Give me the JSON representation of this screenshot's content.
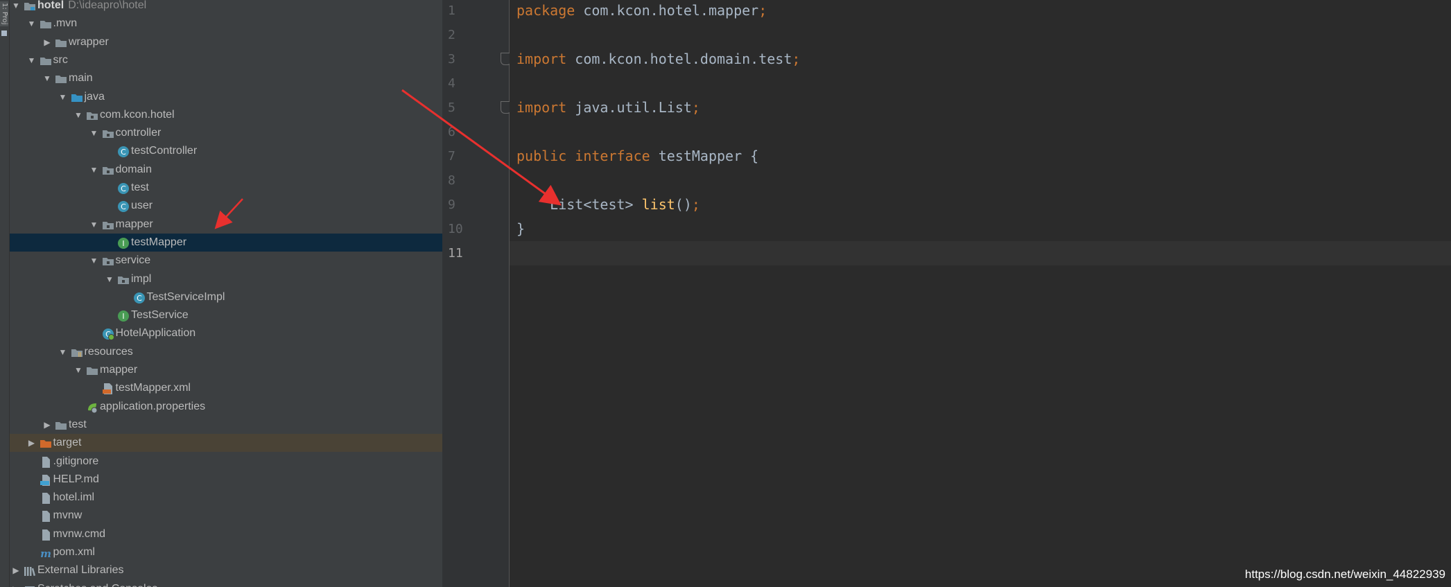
{
  "tool_strip": {
    "label": "1: Proj"
  },
  "project_tree": {
    "rows": [
      {
        "name": "tree-root-hotel",
        "label": "hotel",
        "hint": "D:\\ideapro\\hotel",
        "icon": "module-folder-icon",
        "arrow": "expanded"
      },
      {
        "name": "tree-mvn",
        "label": ".mvn",
        "icon": "folder-icon",
        "arrow": "expanded"
      },
      {
        "name": "tree-wrapper",
        "label": "wrapper",
        "icon": "folder-icon",
        "arrow": "collapsed"
      },
      {
        "name": "tree-src",
        "label": "src",
        "icon": "folder-icon",
        "arrow": "expanded"
      },
      {
        "name": "tree-main",
        "label": "main",
        "icon": "folder-icon",
        "arrow": "expanded"
      },
      {
        "name": "tree-java",
        "label": "java",
        "icon": "source-folder-icon",
        "arrow": "expanded"
      },
      {
        "name": "tree-package-hotel",
        "label": "com.kcon.hotel",
        "icon": "package-icon",
        "arrow": "expanded"
      },
      {
        "name": "tree-controller",
        "label": "controller",
        "icon": "package-icon",
        "arrow": "expanded"
      },
      {
        "name": "tree-testcontroller",
        "label": "testController",
        "icon": "class-icon",
        "arrow": "none"
      },
      {
        "name": "tree-domain",
        "label": "domain",
        "icon": "package-icon",
        "arrow": "expanded"
      },
      {
        "name": "tree-test-class",
        "label": "test",
        "icon": "class-icon",
        "arrow": "none"
      },
      {
        "name": "tree-user-class",
        "label": "user",
        "icon": "class-icon",
        "arrow": "none"
      },
      {
        "name": "tree-mapper",
        "label": "mapper",
        "icon": "package-icon",
        "arrow": "expanded"
      },
      {
        "name": "tree-testmapper",
        "label": "testMapper",
        "icon": "interface-icon",
        "arrow": "none",
        "selected": true
      },
      {
        "name": "tree-service",
        "label": "service",
        "icon": "package-icon",
        "arrow": "expanded"
      },
      {
        "name": "tree-impl",
        "label": "impl",
        "icon": "package-icon",
        "arrow": "expanded"
      },
      {
        "name": "tree-testserviceimpl",
        "label": "TestServiceImpl",
        "icon": "class-icon",
        "arrow": "none"
      },
      {
        "name": "tree-testservice",
        "label": "TestService",
        "icon": "interface-icon",
        "arrow": "none"
      },
      {
        "name": "tree-hotelapplication",
        "label": "HotelApplication",
        "icon": "spring-boot-class-icon",
        "arrow": "none"
      },
      {
        "name": "tree-resources",
        "label": "resources",
        "icon": "resources-folder-icon",
        "arrow": "expanded"
      },
      {
        "name": "tree-resources-mapper",
        "label": "mapper",
        "icon": "folder-icon",
        "arrow": "expanded"
      },
      {
        "name": "tree-testmapper-xml",
        "label": "testMapper.xml",
        "icon": "xml-file-icon",
        "arrow": "none"
      },
      {
        "name": "tree-application-properties",
        "label": "application.properties",
        "icon": "spring-properties-icon",
        "arrow": "none"
      },
      {
        "name": "tree-test-folder",
        "label": "test",
        "icon": "folder-icon",
        "arrow": "collapsed"
      },
      {
        "name": "tree-target",
        "label": "target",
        "icon": "excluded-folder-icon",
        "arrow": "collapsed",
        "excluded": true
      },
      {
        "name": "tree-gitignore",
        "label": ".gitignore",
        "icon": "text-file-icon",
        "arrow": "none"
      },
      {
        "name": "tree-help-md",
        "label": "HELP.md",
        "icon": "markdown-file-icon",
        "arrow": "none"
      },
      {
        "name": "tree-hotel-iml",
        "label": "hotel.iml",
        "icon": "text-file-icon",
        "arrow": "none"
      },
      {
        "name": "tree-mvnw",
        "label": "mvnw",
        "icon": "text-file-icon",
        "arrow": "none"
      },
      {
        "name": "tree-mvnw-cmd",
        "label": "mvnw.cmd",
        "icon": "text-file-icon",
        "arrow": "none"
      },
      {
        "name": "tree-pom-xml",
        "label": "pom.xml",
        "icon": "maven-file-icon",
        "arrow": "none"
      },
      {
        "name": "tree-external-libraries",
        "label": "External Libraries",
        "icon": "library-icon",
        "arrow": "collapsed"
      },
      {
        "name": "tree-scratches",
        "label": "Scratches and Consoles",
        "icon": "scratches-icon",
        "arrow": "collapsed"
      }
    ]
  },
  "editor": {
    "current_line": "11",
    "line_numbers": [
      "1",
      "2",
      "3",
      "4",
      "5",
      "6",
      "7",
      "8",
      "9",
      "10",
      "11"
    ],
    "lines": [
      {
        "tokens": [
          {
            "t": "package",
            "c": "kw"
          },
          {
            "t": " com.kcon.hotel.mapper",
            "c": "ty"
          },
          {
            "t": ";",
            "c": "semi"
          }
        ]
      },
      {
        "tokens": []
      },
      {
        "tokens": [
          {
            "t": "import",
            "c": "kw"
          },
          {
            "t": " com.kcon.hotel.domain.test",
            "c": "ty"
          },
          {
            "t": ";",
            "c": "semi"
          }
        ]
      },
      {
        "tokens": []
      },
      {
        "tokens": [
          {
            "t": "import",
            "c": "kw"
          },
          {
            "t": " java.util.List",
            "c": "ty"
          },
          {
            "t": ";",
            "c": "semi"
          }
        ]
      },
      {
        "tokens": []
      },
      {
        "tokens": [
          {
            "t": "public",
            "c": "kw"
          },
          {
            "t": " ",
            "c": "ty"
          },
          {
            "t": "interface",
            "c": "kw"
          },
          {
            "t": " testMapper {",
            "c": "ty"
          }
        ]
      },
      {
        "tokens": []
      },
      {
        "tokens": [
          {
            "t": "    List<test> ",
            "c": "ty"
          },
          {
            "t": "list",
            "c": "fn"
          },
          {
            "t": "()",
            "c": "ty"
          },
          {
            "t": ";",
            "c": "semi"
          }
        ]
      },
      {
        "tokens": [
          {
            "t": "}",
            "c": "ty"
          }
        ]
      },
      {
        "tokens": []
      }
    ]
  },
  "watermark": "https://blog.csdn.net/weixin_44822939",
  "colors": {
    "keyword": "#cc7832",
    "identifier": "#a9b7c6",
    "method": "#ffc66d",
    "selection": "#0d293e",
    "annotation_arrow": "#e8302e"
  }
}
